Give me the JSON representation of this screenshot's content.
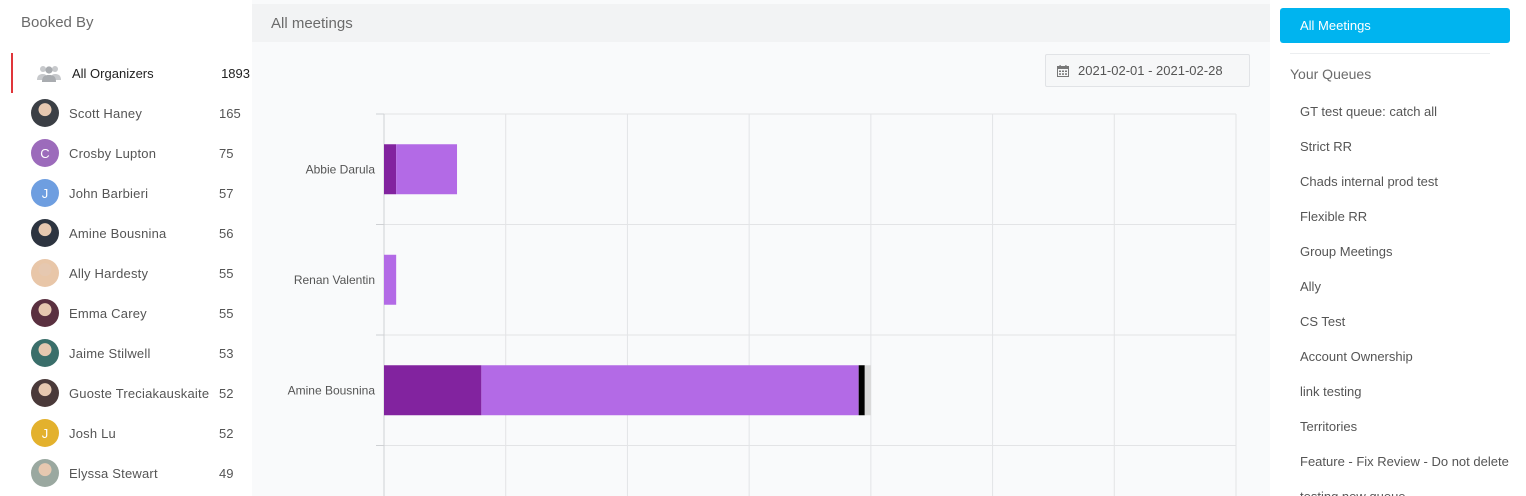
{
  "left": {
    "title": "Booked By",
    "all": {
      "name": "All Organizers",
      "count": "1893",
      "icon": "people-group-icon"
    },
    "organizers": [
      {
        "name": "Scott Haney",
        "count": "165",
        "avatar": "photo",
        "color": "#3b3f45"
      },
      {
        "name": "Crosby Lupton",
        "count": "75",
        "avatar": "C",
        "color": "#9c6bbb"
      },
      {
        "name": "John Barbieri",
        "count": "57",
        "avatar": "J",
        "color": "#6e9ee0"
      },
      {
        "name": "Amine Bousnina",
        "count": "56",
        "avatar": "photo",
        "color": "#2d3440"
      },
      {
        "name": "Ally Hardesty",
        "count": "55",
        "avatar": "photo",
        "color": "#e8c6a8"
      },
      {
        "name": "Emma Carey",
        "count": "55",
        "avatar": "photo",
        "color": "#5a3040"
      },
      {
        "name": "Jaime Stilwell",
        "count": "53",
        "avatar": "photo",
        "color": "#3a6e6a"
      },
      {
        "name": "Guoste Treciakauskaite",
        "count": "52",
        "avatar": "photo",
        "color": "#4a3a3a"
      },
      {
        "name": "Josh Lu",
        "count": "52",
        "avatar": "J",
        "color": "#e3b12d"
      },
      {
        "name": "Elyssa Stewart",
        "count": "49",
        "avatar": "photo",
        "color": "#9aa8a0"
      }
    ]
  },
  "main": {
    "title": "All meetings",
    "date_range": "2021-02-01 - 2021-02-28",
    "date_icon": "calendar-icon"
  },
  "chart_data": {
    "type": "bar",
    "orientation": "horizontal",
    "stacked": true,
    "categories": [
      "Abbie Darula",
      "Renan Valentin",
      "Amine Bousnina"
    ],
    "series": [
      {
        "values": [
          1,
          0,
          8
        ],
        "color": "#82239f"
      },
      {
        "values": [
          5,
          1,
          31
        ],
        "color": "#b36ae6"
      },
      {
        "values": [
          0,
          0,
          0.5
        ],
        "color": "#000000"
      },
      {
        "values": [
          0,
          0,
          0.5
        ],
        "color": "#d9d9d9"
      }
    ],
    "xlim": [
      0,
      70
    ],
    "grid": true
  },
  "right": {
    "all_meetings_label": "All Meetings",
    "accent": "#00b4ef",
    "queues_title": "Your Queues",
    "queues": [
      "GT test queue: catch all",
      "Strict RR",
      "Chads internal prod test",
      "Flexible RR",
      "Group Meetings",
      "Ally",
      "CS Test",
      "Account Ownership",
      "link testing",
      "Territories",
      "Feature - Fix Review - Do not delete",
      "testing new queue"
    ]
  }
}
